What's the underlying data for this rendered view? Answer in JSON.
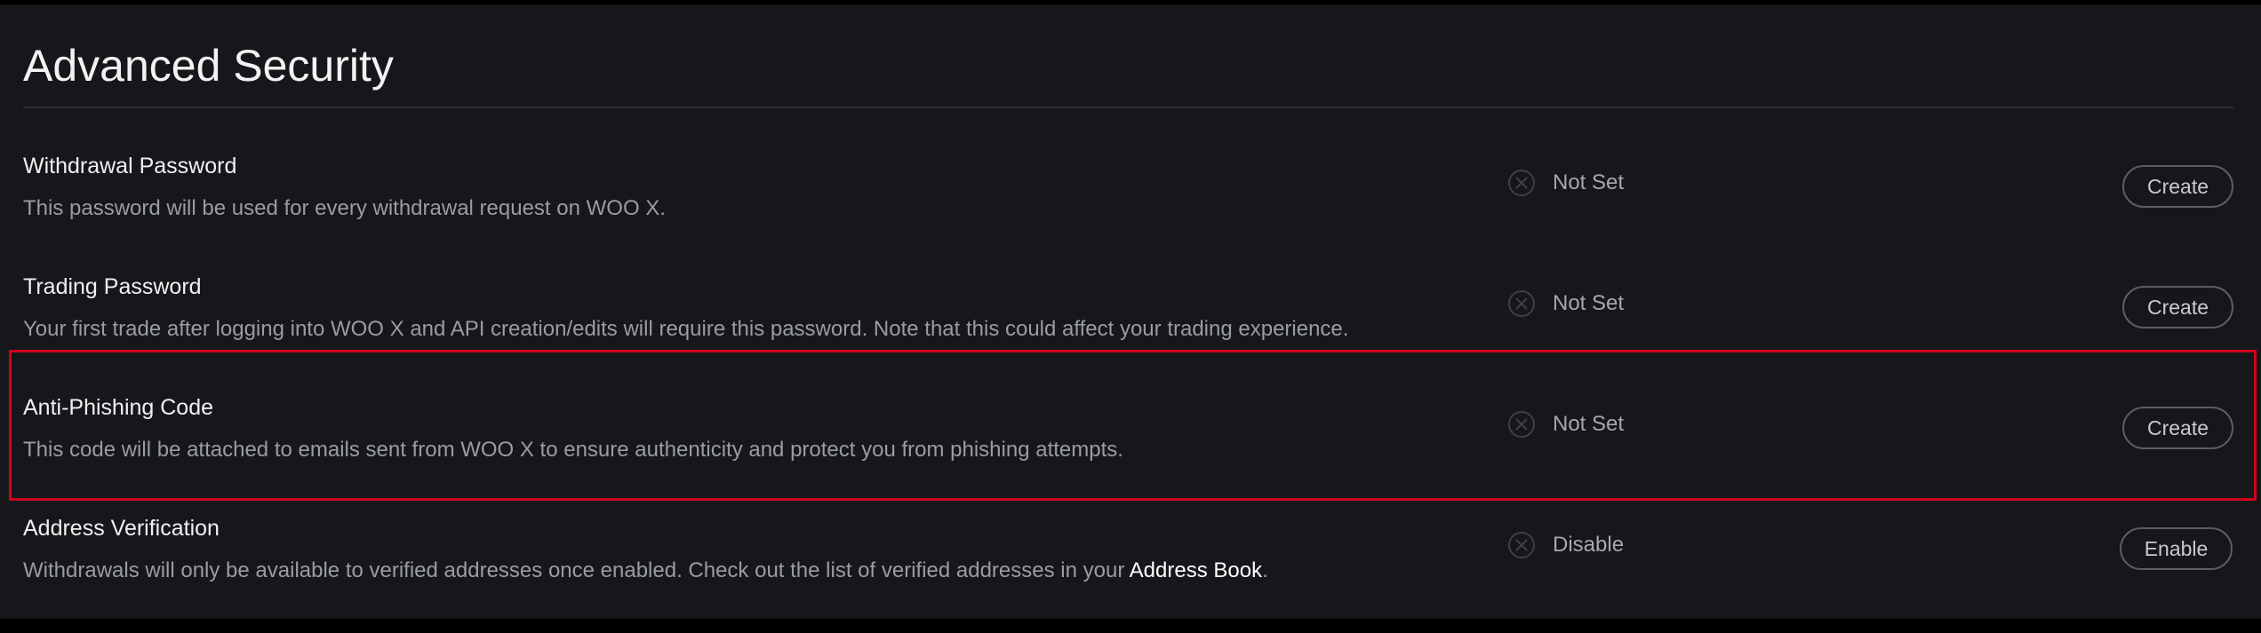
{
  "page": {
    "title": "Advanced Security"
  },
  "settings": [
    {
      "key": "withdrawal_password",
      "title": "Withdrawal Password",
      "description": "This password will be used for every withdrawal request on WOO X.",
      "status": "Not Set",
      "status_icon": "x-circle-icon",
      "action_label": "Create"
    },
    {
      "key": "trading_password",
      "title": "Trading Password",
      "description": "Your first trade after logging into WOO X and API creation/edits will require this password. Note that this could affect your trading experience.",
      "status": "Not Set",
      "status_icon": "x-circle-icon",
      "action_label": "Create"
    },
    {
      "key": "anti_phishing_code",
      "title": "Anti-Phishing Code",
      "description": "This code will be attached to emails sent from WOO X to ensure authenticity and protect you from phishing attempts.",
      "status": "Not Set",
      "status_icon": "x-circle-icon",
      "action_label": "Create",
      "highlighted": true
    },
    {
      "key": "address_verification",
      "title": "Address Verification",
      "description_prefix": "Withdrawals will only be available to verified addresses once enabled. Check out the list of verified addresses in your ",
      "description_link": "Address Book",
      "description_suffix": ".",
      "status": "Disable",
      "status_icon": "x-circle-icon",
      "action_label": "Enable"
    }
  ],
  "colors": {
    "background": "#16171b",
    "title_text": "#f2f2f2",
    "description_text": "#9a9ca3",
    "button_border": "#5b5d63",
    "highlight_border": "#d0021b"
  }
}
